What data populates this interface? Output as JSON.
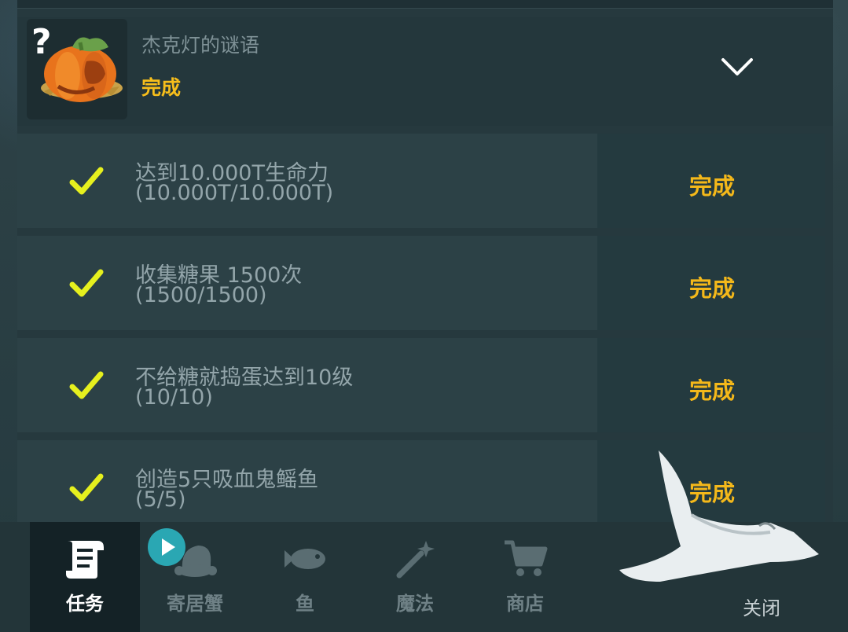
{
  "quest": {
    "title": "杰克灯的谜语",
    "status": "完成",
    "icon": "pumpkin-mystery-icon"
  },
  "tasks": [
    {
      "line1": "达到10.000T生命力",
      "line2": "(10.000T/10.000T)",
      "status": "完成"
    },
    {
      "line1": "收集糖果 1500次",
      "line2": "(1500/1500)",
      "status": "完成"
    },
    {
      "line1": "不给糖就捣蛋达到10级",
      "line2": "(10/10)",
      "status": "完成"
    },
    {
      "line1": "创造5只吸血鬼鳐鱼",
      "line2": "(5/5)",
      "status": "完成"
    }
  ],
  "tabs": [
    {
      "label": "任务",
      "icon": "quest-scroll-icon",
      "active": true
    },
    {
      "label": "寄居蟹",
      "icon": "hermit-crab-icon"
    },
    {
      "label": "鱼",
      "icon": "fish-icon"
    },
    {
      "label": "魔法",
      "icon": "magic-wand-icon"
    },
    {
      "label": "商店",
      "icon": "shopping-cart-icon"
    }
  ],
  "close_label": "关闭",
  "colors": {
    "accent_done": "#f4b81a",
    "check": "#e6f01e",
    "panel": "#26393e"
  }
}
